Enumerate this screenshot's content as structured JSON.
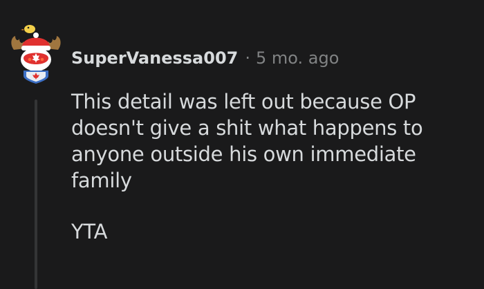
{
  "comment": {
    "author": "SuperVanessa007",
    "separator": "·",
    "timestamp": "5 mo. ago",
    "avatar_icon": "snoo-moose-canada-avatar-icon",
    "paragraphs": [
      "This detail was left out because OP doesn't give a shit what happens to anyone outside his own immediate family",
      "YTA"
    ]
  },
  "colors": {
    "background": "#1a1a1b",
    "text": "#d7dadc",
    "muted": "#818384",
    "thread_line": "#343536",
    "avatar_red": "#e0312f"
  }
}
